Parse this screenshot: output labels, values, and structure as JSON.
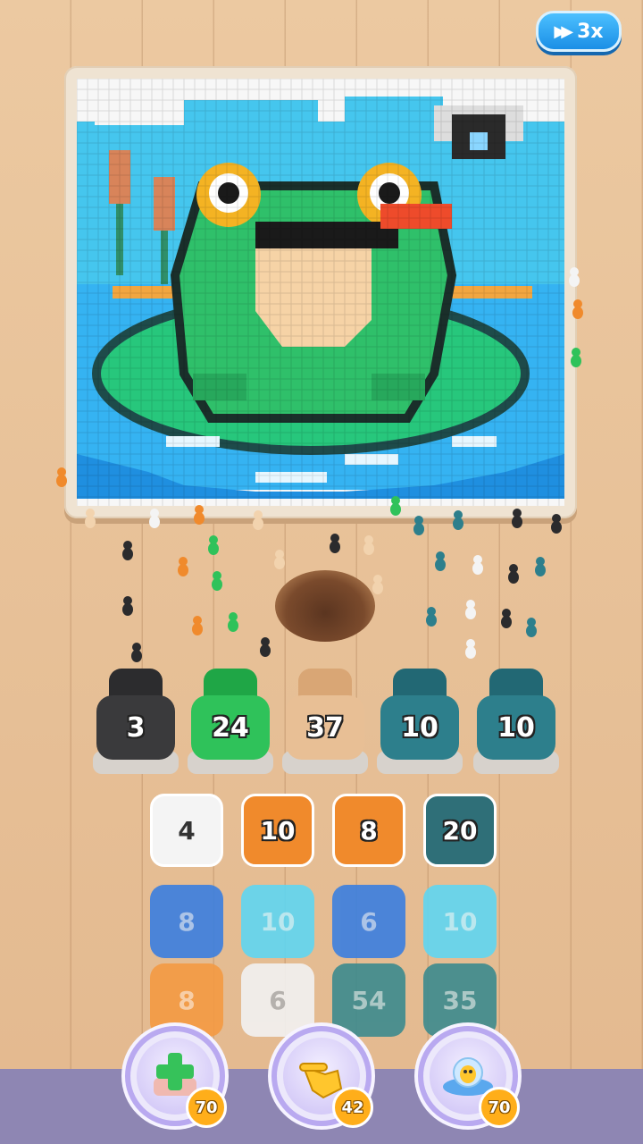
{
  "speed_button": {
    "label": "3x",
    "icon": "fast-forward-icon"
  },
  "bins": [
    {
      "count": "3",
      "color": "#3a3a3c",
      "top": "#2c2c2e"
    },
    {
      "count": "24",
      "color": "#2fc25a",
      "top": "#1fa646"
    },
    {
      "count": "37",
      "color": "#e8bf95",
      "top": "#d9a675"
    },
    {
      "count": "10",
      "color": "#2d7f8c",
      "top": "#226874"
    },
    {
      "count": "10",
      "color": "#2d7f8c",
      "top": "#226874"
    }
  ],
  "tiles": [
    {
      "value": "4",
      "color": "#f4f4f4",
      "state": "active",
      "text": "#333"
    },
    {
      "value": "10",
      "color": "#f08a2c",
      "state": "active"
    },
    {
      "value": "8",
      "color": "#f08a2c",
      "state": "active"
    },
    {
      "value": "20",
      "color": "#2f6f78",
      "state": "active"
    },
    {
      "value": "8",
      "color": "#3b7fe0",
      "state": "faded"
    },
    {
      "value": "10",
      "color": "#5fd6f2",
      "state": "faded"
    },
    {
      "value": "6",
      "color": "#3b7fe0",
      "state": "faded"
    },
    {
      "value": "10",
      "color": "#5fd6f2",
      "state": "faded"
    },
    {
      "value": "8",
      "color": "#f49a43",
      "state": "faded"
    },
    {
      "value": "6",
      "color": "#f2f2f2",
      "state": "faded"
    },
    {
      "value": "54",
      "color": "#3c8b8e",
      "state": "faded"
    },
    {
      "value": "35",
      "color": "#3c8b8e",
      "state": "faded"
    }
  ],
  "boosters": [
    {
      "name": "add-slot",
      "icon": "plus-icon",
      "cost": "70"
    },
    {
      "name": "hand",
      "icon": "hand-icon",
      "cost": "42"
    },
    {
      "name": "ufo",
      "icon": "ufo-icon",
      "cost": "70"
    }
  ],
  "picture": {
    "subject": "frog-on-lily-pad",
    "icon": "pixel-frog-icon"
  }
}
